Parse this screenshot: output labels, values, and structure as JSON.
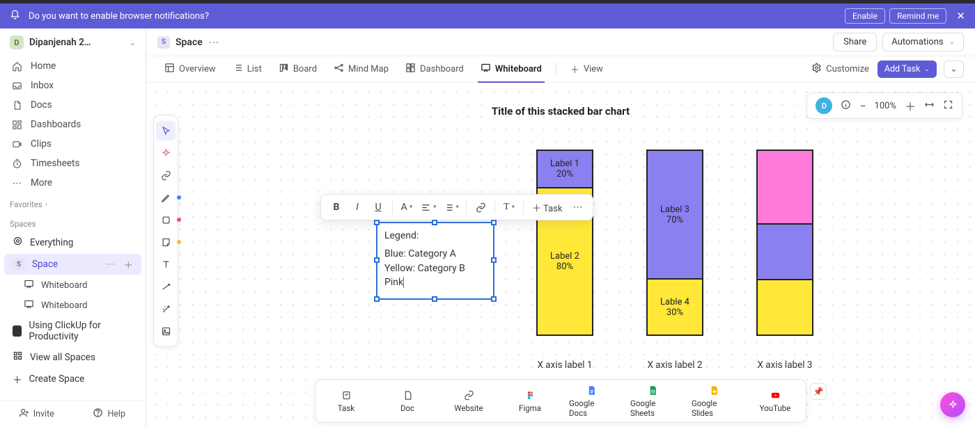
{
  "notification": {
    "message": "Do you want to enable browser notifications?",
    "enable": "Enable",
    "remind": "Remind me"
  },
  "workspace": {
    "initial": "D",
    "name": "Dipanjenah 2…"
  },
  "nav": {
    "home": "Home",
    "inbox": "Inbox",
    "docs": "Docs",
    "dashboards": "Dashboards",
    "clips": "Clips",
    "timesheets": "Timesheets",
    "more": "More"
  },
  "sections": {
    "favorites": "Favorites",
    "spaces": "Spaces"
  },
  "spaces": {
    "everything": "Everything",
    "space": {
      "initial": "S",
      "label": "Space"
    },
    "wb1": "Whiteboard",
    "wb2": "Whiteboard",
    "using": "Using ClickUp for Productivity",
    "viewall": "View all Spaces",
    "create": "Create Space"
  },
  "footer": {
    "invite": "Invite",
    "help": "Help"
  },
  "crumb": {
    "initial": "S",
    "title": "Space",
    "share": "Share",
    "automations": "Automations"
  },
  "views": {
    "overview": "Overview",
    "list": "List",
    "board": "Board",
    "mindmap": "Mind Map",
    "dashboard": "Dashboard",
    "whiteboard": "Whiteboard",
    "addview": "View",
    "customize": "Customize",
    "addtask": "Add Task"
  },
  "toolbar": {
    "avatar": "D",
    "zoom": "100%"
  },
  "textbox": {
    "line1": "Legend:",
    "line2": "Blue: Category A",
    "line3": "Yellow: Category B",
    "line4": "Pink"
  },
  "fmt": {
    "task": "Task"
  },
  "tray": {
    "task": "Task",
    "doc": "Doc",
    "website": "Website",
    "figma": "Figma",
    "gdocs": "Google Docs",
    "gsheets": "Google Sheets",
    "gslides": "Google Slides",
    "youtube": "YouTube"
  },
  "chart_data": {
    "type": "bar",
    "title": "Title of this stacked bar chart",
    "categories": [
      "X axis label 1",
      "X axis label 2",
      "X axis label 3"
    ],
    "legend": {
      "blue": "Category A",
      "yellow": "Category B",
      "pink": "Pink (unlabeled)"
    },
    "colors": {
      "blue": "#8a80f0",
      "yellow": "#ffe838",
      "pink": "#ff7ad9"
    },
    "series_stacked": [
      {
        "x": "X axis label 1",
        "segments": [
          {
            "label": "Label 1",
            "value_pct": 20,
            "color": "blue"
          },
          {
            "label": "Label 2",
            "value_pct": 80,
            "color": "yellow"
          }
        ]
      },
      {
        "x": "X axis label 2",
        "segments": [
          {
            "label": "Label 3",
            "value_pct": 70,
            "color": "blue"
          },
          {
            "label": "Lable 4",
            "value_pct": 30,
            "color": "yellow"
          }
        ]
      },
      {
        "x": "X axis label 3",
        "segments": [
          {
            "label": "",
            "value_pct": 40,
            "color": "pink"
          },
          {
            "label": "",
            "value_pct": 30,
            "color": "blue"
          },
          {
            "label": "",
            "value_pct": 30,
            "color": "yellow"
          }
        ]
      }
    ]
  }
}
